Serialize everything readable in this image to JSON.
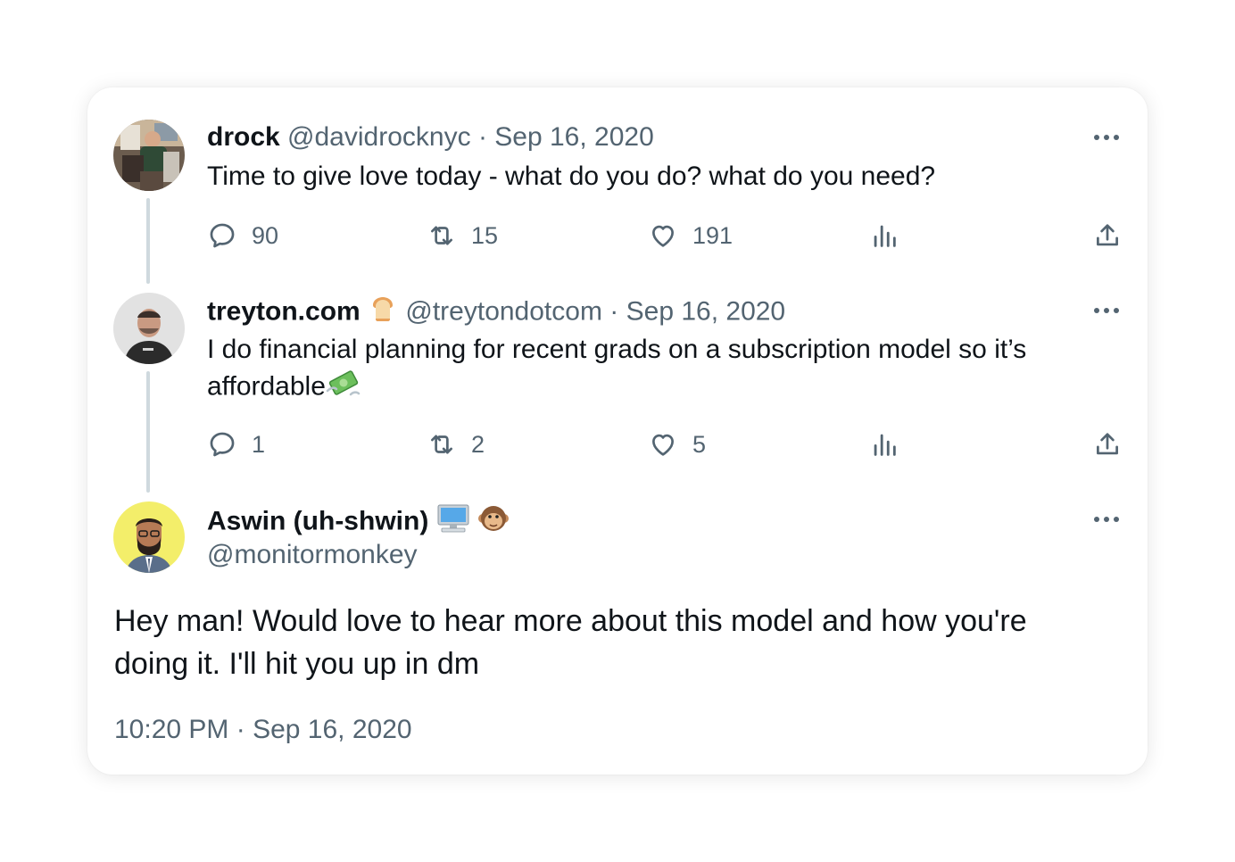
{
  "tweets": [
    {
      "name": "drock",
      "handle": "@davidrocknyc",
      "dot": "·",
      "date": "Sep 16, 2020",
      "text": "Time to give love today - what do you do? what do you need?",
      "replies": "90",
      "retweets": "15",
      "likes": "191"
    },
    {
      "name": "treyton.com",
      "handle": "@treytondotcom",
      "dot": "·",
      "date": "Sep 16, 2020",
      "text": "I do financial planning for recent grads on a subscription model so it’s affordable",
      "replies": "1",
      "retweets": "2",
      "likes": "5"
    }
  ],
  "main": {
    "name": "Aswin (uh-shwin)",
    "handle": "@monitormonkey",
    "text": "Hey man! Would love to hear more about this model and how you're doing it. I'll hit you up in dm",
    "timestamp": "10:20 PM · Sep 16, 2020"
  },
  "icons": {
    "reply": "reply-icon",
    "retweet": "retweet-icon",
    "like": "heart-icon",
    "views": "views-icon",
    "share": "share-icon",
    "more": "more-icon"
  },
  "colors": {
    "text": "#0f1419",
    "secondary": "#536471",
    "thread_line": "#cfd9de"
  }
}
